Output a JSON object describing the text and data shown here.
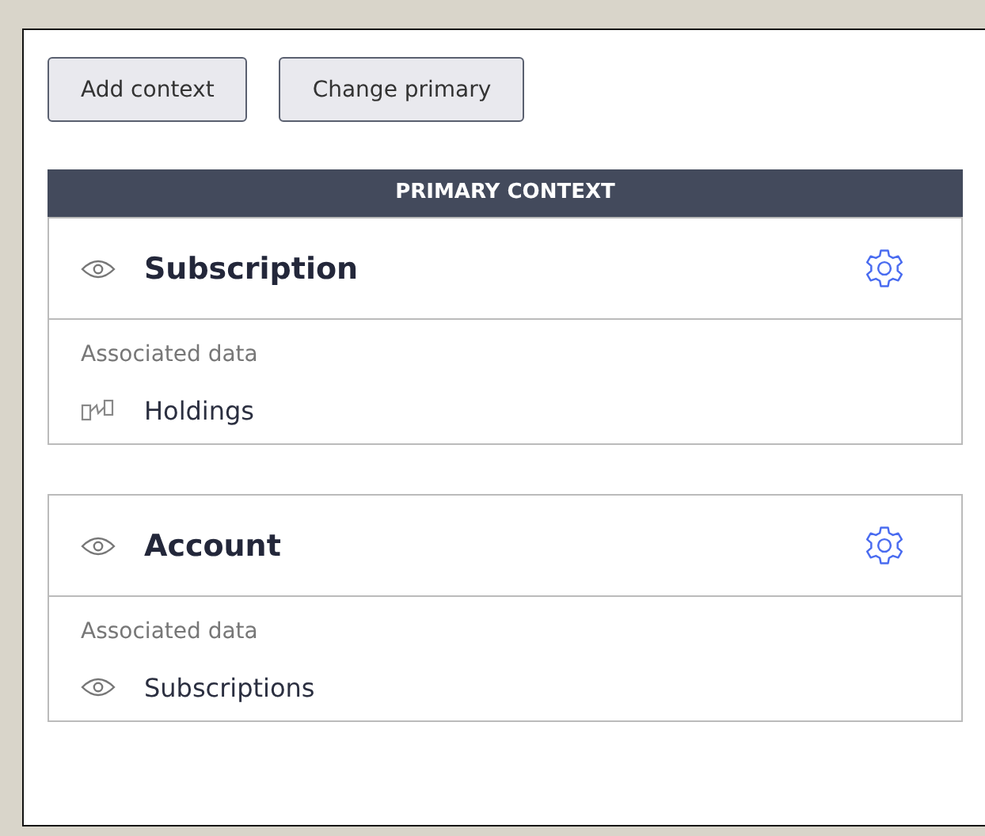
{
  "buttons": [
    "Add context",
    "Change primary"
  ],
  "contexts": [
    {
      "banner": "PRIMARY CONTEXT",
      "title": "Subscription",
      "section_label": "Associated data",
      "items": [
        {
          "kind": "relation",
          "label": "Holdings"
        }
      ]
    },
    {
      "title": "Account",
      "section_label": "Associated data",
      "items": [
        {
          "kind": "entity",
          "label": "Subscriptions"
        }
      ]
    }
  ]
}
